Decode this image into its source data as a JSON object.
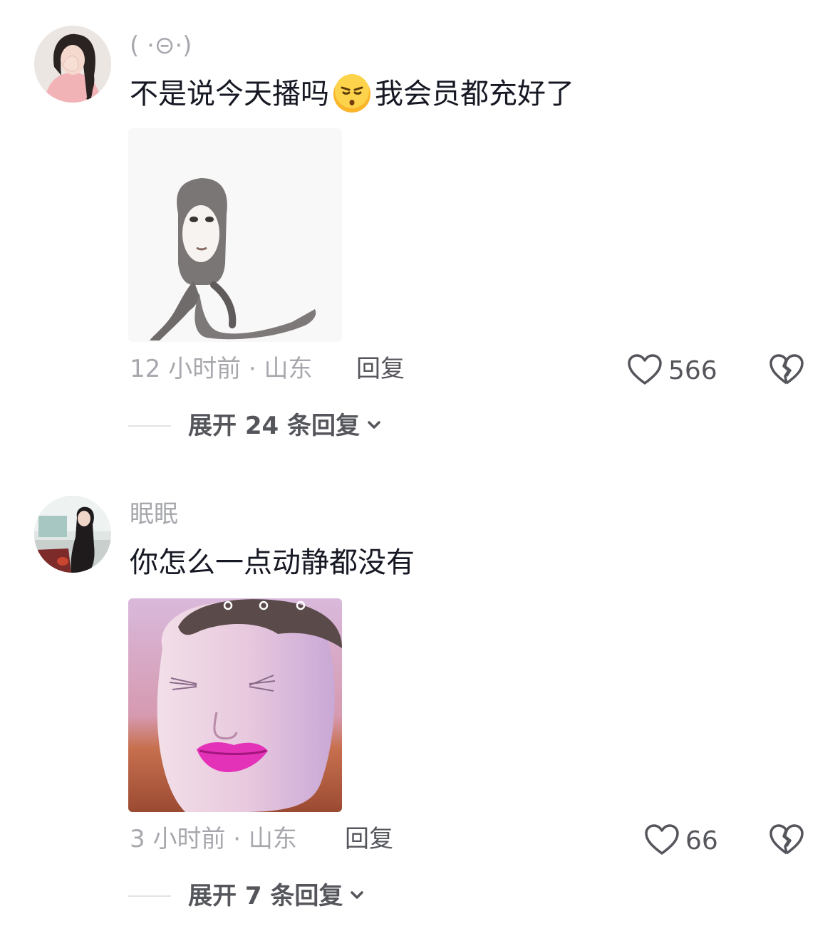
{
  "comments": [
    {
      "username": "( ·⊝·)",
      "text_before": "不是说今天播吗",
      "inline_emoji": "smirk-emoji",
      "text_after": "我会员都充好了",
      "sticker": "gray-mask-figure-sitting-sticker",
      "time": "12 小时前",
      "location": "山东",
      "meta_separator": " · ",
      "reply_label": "回复",
      "likes": "566",
      "expand_label": "展开 24 条回复"
    },
    {
      "username": "眠眠",
      "text_before": "你怎么一点动静都没有",
      "sticker": "pink-lips-face-sticker",
      "time": "3 小时前",
      "location": "山东",
      "meta_separator": " · ",
      "reply_label": "回复",
      "likes": "66",
      "expand_label": "展开 7 条回复"
    }
  ],
  "icons": {
    "like": "heart-outline-icon",
    "dislike": "broken-heart-icon",
    "expand": "chevron-down-icon"
  },
  "colors": {
    "primary_text": "#161823",
    "secondary_text": "#a7a8ad",
    "action_text": "#55565c"
  }
}
